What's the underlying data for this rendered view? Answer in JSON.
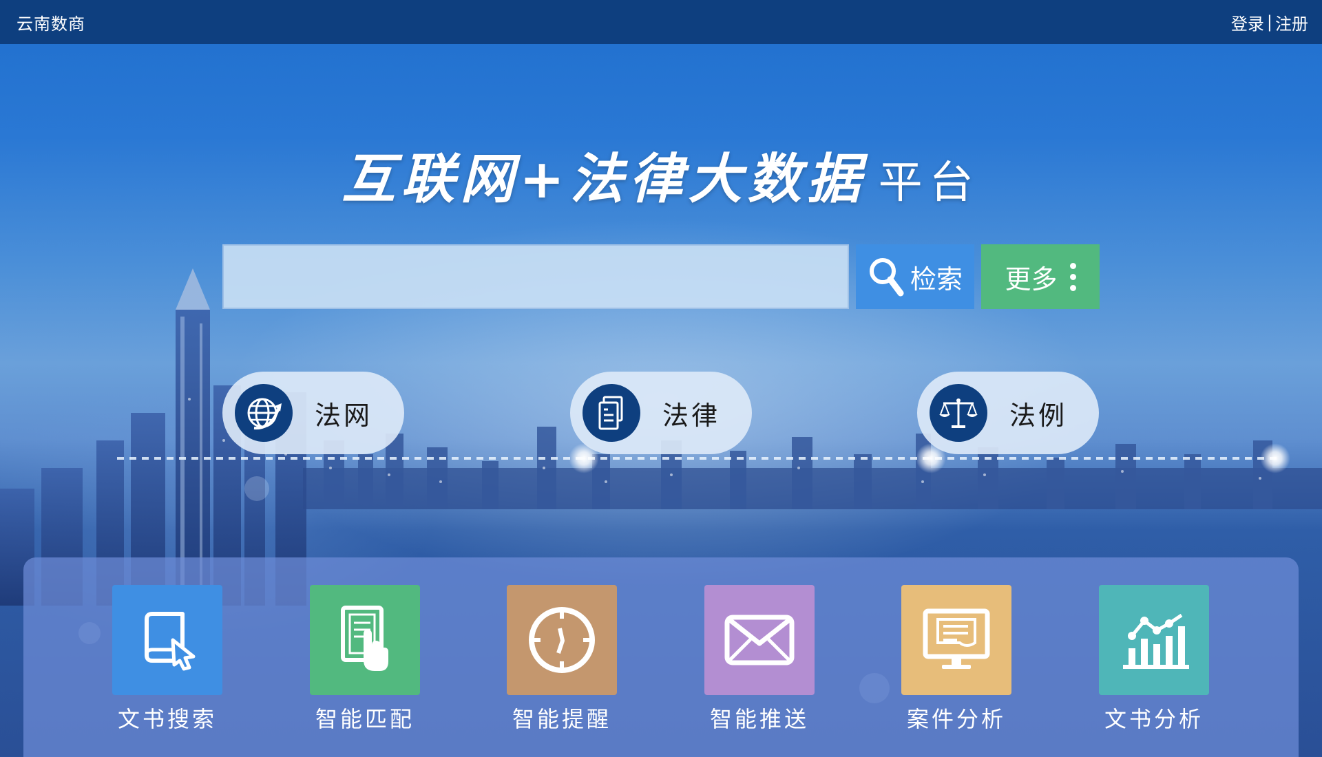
{
  "topbar": {
    "brand": "云南数商",
    "login": "登录",
    "separator": "|",
    "register": "注册"
  },
  "hero": {
    "title_main": "互联网+法律大数据",
    "title_suffix": "平台"
  },
  "search": {
    "value": "",
    "placeholder": "",
    "search_label": "检索",
    "more_label": "更多"
  },
  "categories": [
    {
      "label": "法网",
      "icon": "globe-icon"
    },
    {
      "label": "法律",
      "icon": "document-icon"
    },
    {
      "label": "法例",
      "icon": "scales-icon"
    }
  ],
  "features": [
    {
      "label": "文书搜索",
      "icon": "book-cursor-icon",
      "color": "#3f8fe3"
    },
    {
      "label": "智能匹配",
      "icon": "document-touch-icon",
      "color": "#52b97f"
    },
    {
      "label": "智能提醒",
      "icon": "clock-icon",
      "color": "#c4976e"
    },
    {
      "label": "智能推送",
      "icon": "mail-icon",
      "color": "#b38ed2"
    },
    {
      "label": "案件分析",
      "icon": "monitor-icon",
      "color": "#e7bd7a"
    },
    {
      "label": "文书分析",
      "icon": "bar-chart-icon",
      "color": "#4fb6b8"
    }
  ]
}
